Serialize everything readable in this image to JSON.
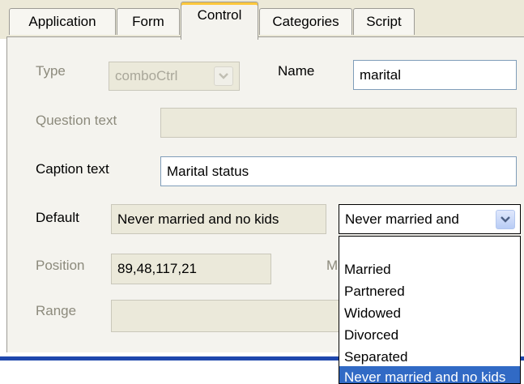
{
  "tabs": [
    {
      "label": "Application"
    },
    {
      "label": "Form"
    },
    {
      "label": "Control"
    },
    {
      "label": "Categories"
    },
    {
      "label": "Script"
    }
  ],
  "active_tab": "Control",
  "form": {
    "type_label": "Type",
    "type_value": "comboCtrl",
    "name_label": "Name",
    "name_value": "marital",
    "question_label": "Question text",
    "question_value": "",
    "caption_label": "Caption text",
    "caption_value": "Marital status",
    "default_label": "Default",
    "default_value": "Never married and no kids",
    "default_combo_value": "Never married and",
    "position_label": "Position",
    "position_value": "89,48,117,21",
    "hidden_label_fragment": "M",
    "range_label": "Range",
    "range_value": ""
  },
  "dropdown": {
    "items": [
      {
        "label": ""
      },
      {
        "label": "Married"
      },
      {
        "label": "Partnered"
      },
      {
        "label": "Widowed"
      },
      {
        "label": "Divorced"
      },
      {
        "label": "Separated"
      },
      {
        "label": "Never married and no kids"
      }
    ],
    "selected_index": 6
  },
  "colors": {
    "selection": "#316ac5",
    "active_tab_accent": "#ffc83c",
    "panel_bg": "#f4f3ee",
    "disabled_text": "#8c8a7c"
  },
  "icons": {
    "combo_arrow": "chevron-down-icon"
  }
}
